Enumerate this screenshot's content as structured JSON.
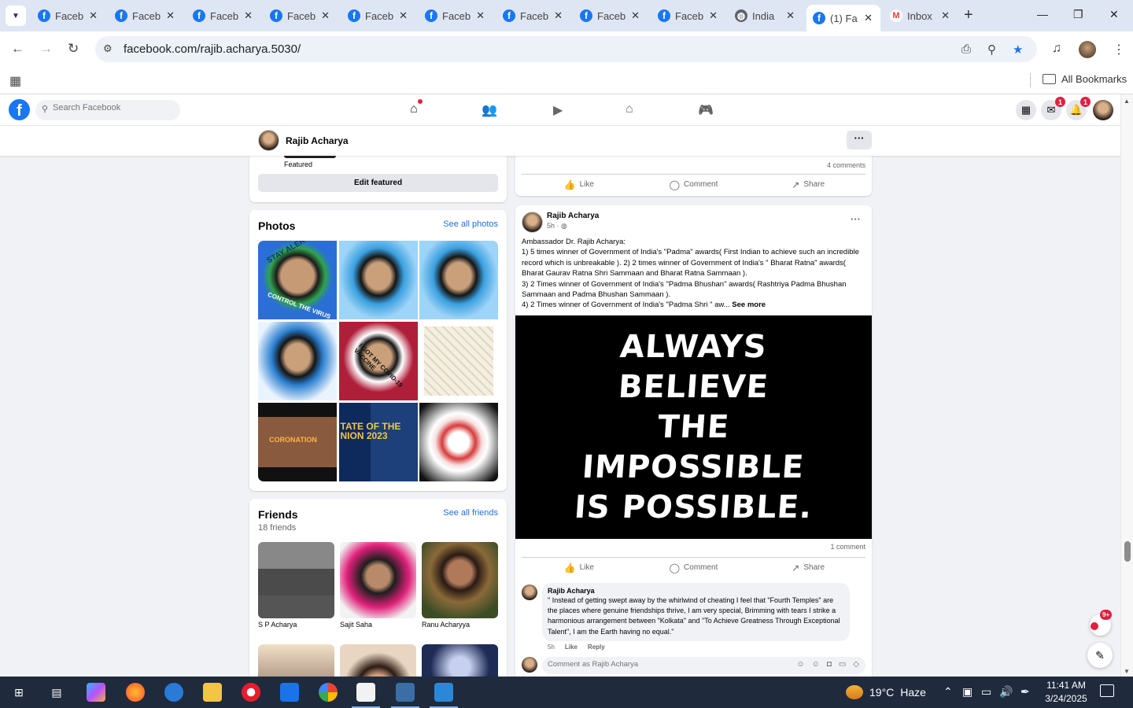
{
  "browser": {
    "tabs": [
      {
        "label": "Faceb",
        "icon": "facebook-icon"
      },
      {
        "label": "Faceb",
        "icon": "facebook-icon"
      },
      {
        "label": "Faceb",
        "icon": "facebook-icon"
      },
      {
        "label": "Faceb",
        "icon": "facebook-icon"
      },
      {
        "label": "Faceb",
        "icon": "facebook-icon"
      },
      {
        "label": "Faceb",
        "icon": "facebook-icon"
      },
      {
        "label": "Faceb",
        "icon": "facebook-icon"
      },
      {
        "label": "Faceb",
        "icon": "facebook-icon"
      },
      {
        "label": "Faceb",
        "icon": "facebook-icon"
      },
      {
        "label": "India",
        "icon": "globe-icon"
      },
      {
        "label": "(1) Fa",
        "icon": "facebook-icon",
        "active": true
      },
      {
        "label": "Inbox",
        "icon": "gmail-icon"
      }
    ],
    "url": "facebook.com/rajib.acharya.5030/",
    "bookmarks_label": "All Bookmarks"
  },
  "facebook": {
    "search_placeholder": "Search Facebook",
    "messenger_badge": "1",
    "notifications_badge": "1",
    "brand_color": "#1877f2"
  },
  "profile_bar": {
    "name": "Rajib Acharya",
    "more": "···"
  },
  "featured": {
    "label": "Featured",
    "edit_button": "Edit featured"
  },
  "photos": {
    "title": "Photos",
    "see_all": "See all photos",
    "overlay_texts": [
      "STAY ALERT",
      "CONTROL THE VIRUS",
      "I GOT MY COVID-19 VACCINE",
      "CORONATION",
      "TATE OF THE NION 2023"
    ]
  },
  "friends": {
    "title": "Friends",
    "see_all": "See all friends",
    "count": "18 friends",
    "list": [
      {
        "name": "S P Acharya"
      },
      {
        "name": "Sajit Saha"
      },
      {
        "name": "Ranu Acharyya"
      },
      {
        "name": ""
      },
      {
        "name": ""
      },
      {
        "name": ""
      }
    ]
  },
  "post1": {
    "comments": "4 comments",
    "like": "Like",
    "comment": "Comment",
    "share": "Share"
  },
  "post2": {
    "author": "Rajib Acharya",
    "time": "5h · ",
    "text_lines": [
      "Ambassador Dr. Rajib Acharya:",
      "1) 5 times winner of Government of India's \"Padma\" awards( First Indian to achieve such an incredible record which is unbreakable ). 2) 2 times winner of Government of India's \" Bharat Ratna\" awards( Bharat Gaurav Ratna Shri Sammaan and Bharat Ratna Sammaan ).",
      "3) 2 Times winner of Government of India's \"Padma Bhushan\" awards( Rashtriya Padma Bhushan Sammaan and Padma Bhushan Sammaan ).",
      "4) 2 Times winner of Government of India's \"Padma Shri \" aw... "
    ],
    "see_more": "See more",
    "image_text": [
      "ALWAYS",
      "BELIEVE",
      "THE",
      "IMPOSSIBLE",
      "IS POSSIBLE."
    ],
    "comment_count": "1 comment",
    "like": "Like",
    "comment": "Comment",
    "share": "Share",
    "top_comment": {
      "author": "Rajib Acharya",
      "text": "\" Instead of getting swept away by the whirlwind of cheating I feel that \"Fourth Temples\" are the places where genuine friendships thrive, I am very special, Brimming with tears I strike a harmonious arrangement between \"Kolkata\" and \"To Achieve Greatness Through Exceptional Talent\", I am the Earth having no equal.\"",
      "time": "5h",
      "like": "Like",
      "reply": "Reply"
    },
    "reply_placeholder": "Comment as Rajib Acharya"
  },
  "news_badge": "9+",
  "taskbar": {
    "temperature": "19°C",
    "condition": "Haze",
    "time": "11:41 AM",
    "date": "3/24/2025"
  }
}
